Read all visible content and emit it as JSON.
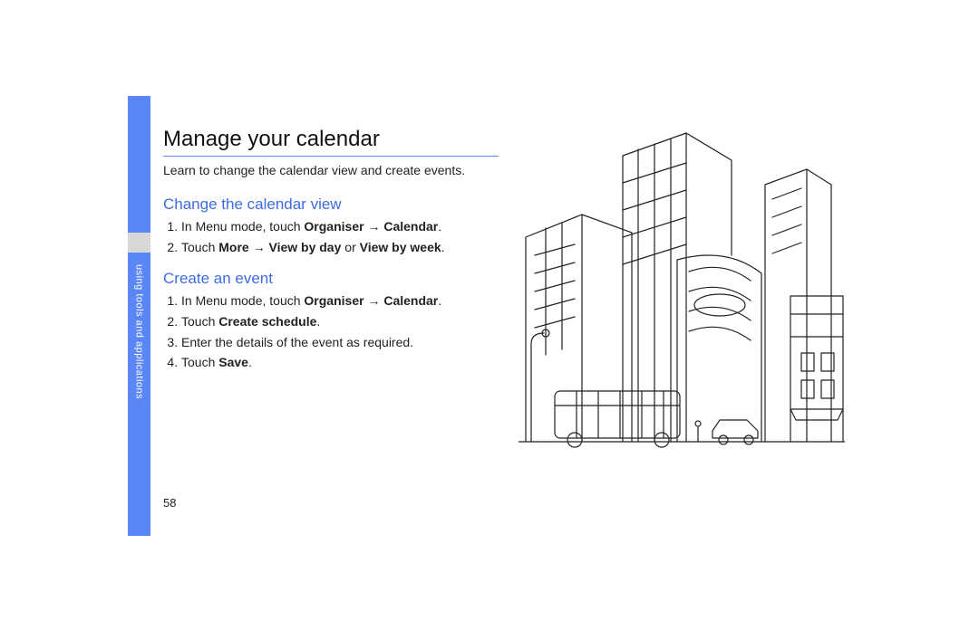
{
  "sidebar": {
    "tab_label": "using tools and applications"
  },
  "page": {
    "title": "Manage your calendar",
    "intro": "Learn to change the calendar view and create events.",
    "number": "58"
  },
  "sections": [
    {
      "heading": "Change the calendar view",
      "steps": [
        {
          "pre": "In Menu mode, touch ",
          "b1": "Organiser",
          "mid1": " → ",
          "b2": "Calendar",
          "post": "."
        },
        {
          "pre": "Touch ",
          "b1": "More",
          "mid1": " → ",
          "b2": "View by day",
          "mid2": " or ",
          "b3": "View by week",
          "post": "."
        }
      ]
    },
    {
      "heading": "Create an event",
      "steps": [
        {
          "pre": "In Menu mode, touch ",
          "b1": "Organiser",
          "mid1": " → ",
          "b2": "Calendar",
          "post": "."
        },
        {
          "pre": "Touch ",
          "b1": "Create schedule",
          "post": "."
        },
        {
          "pre": "Enter the details of the event as required.",
          "post": ""
        },
        {
          "pre": "Touch ",
          "b1": "Save",
          "post": "."
        }
      ]
    }
  ]
}
